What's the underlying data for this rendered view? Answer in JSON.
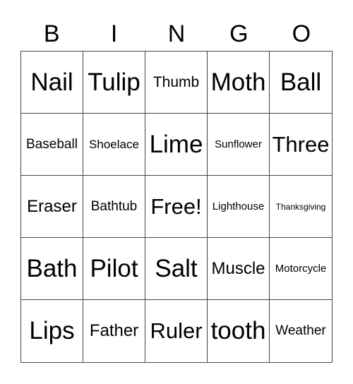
{
  "header": [
    "B",
    "I",
    "N",
    "G",
    "O"
  ],
  "cells": [
    [
      {
        "text": "Nail",
        "size": "s-xl"
      },
      {
        "text": "Tulip",
        "size": "s-xl"
      },
      {
        "text": "Thumb",
        "size": "s-s"
      },
      {
        "text": "Moth",
        "size": "s-xl"
      },
      {
        "text": "Ball",
        "size": "s-xl"
      }
    ],
    [
      {
        "text": "Baseball",
        "size": "s-sm"
      },
      {
        "text": "Shoelace",
        "size": "s-xs"
      },
      {
        "text": "Lime",
        "size": "s-xl"
      },
      {
        "text": "Sunflower",
        "size": "s-xxs"
      },
      {
        "text": "Three",
        "size": "s-l"
      }
    ],
    [
      {
        "text": "Eraser",
        "size": "s-m"
      },
      {
        "text": "Bathtub",
        "size": "s-sm"
      },
      {
        "text": "Free!",
        "size": "s-l"
      },
      {
        "text": "Lighthouse",
        "size": "s-xxs"
      },
      {
        "text": "Thanksgiving",
        "size": "s-tiny"
      }
    ],
    [
      {
        "text": "Bath",
        "size": "s-xl"
      },
      {
        "text": "Pilot",
        "size": "s-xl"
      },
      {
        "text": "Salt",
        "size": "s-xl"
      },
      {
        "text": "Muscle",
        "size": "s-m"
      },
      {
        "text": "Motorcycle",
        "size": "s-xxs"
      }
    ],
    [
      {
        "text": "Lips",
        "size": "s-xl"
      },
      {
        "text": "Father",
        "size": "s-m"
      },
      {
        "text": "Ruler",
        "size": "s-l"
      },
      {
        "text": "tooth",
        "size": "s-xl"
      },
      {
        "text": "Weather",
        "size": "s-sm"
      }
    ]
  ]
}
